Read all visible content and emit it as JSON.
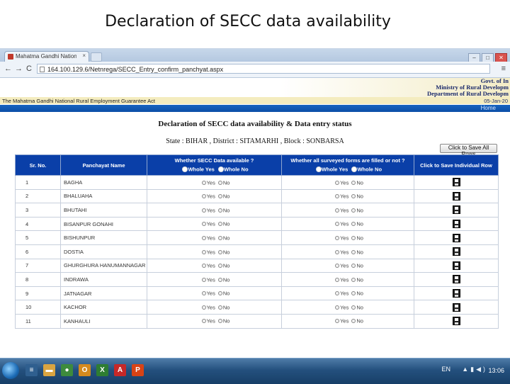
{
  "slide": {
    "title": "Declaration of SECC data availability"
  },
  "browser": {
    "tab_label": "Mahatma Gandhi National",
    "tab_close": "×",
    "window_buttons": [
      "–",
      "□",
      "✕"
    ],
    "back": "←",
    "forward": "→",
    "reload": "C",
    "url": "164.100.129.6/Netnrega/SECC_Entry_confirm_panchyat.aspx",
    "menu": "≡"
  },
  "header": {
    "gov_lines": [
      "Govt. of In",
      "Ministry of Rural Developm",
      "Department of Rural Developm"
    ],
    "act_text": "The Mahatma Gandhi National Rural Employment Guarantee Act",
    "date": "05-Jan-20",
    "home_link": "Home"
  },
  "page": {
    "heading": "Declaration of SECC data availability & Data entry status",
    "state_line": "State : BIHAR , District : SITAMARHI , Block : SONBARSA",
    "save_all_button": "Click to Save All Rows"
  },
  "table": {
    "headers": {
      "sr_no": "Sr. No.",
      "panchayat": "Panchayat Name",
      "secc_q": "Whether SECC Data available ?",
      "forms_q": "Whether all surveyed forms are filled or not ?",
      "save_col": "Click to Save Individual Row",
      "whole_yes": "Whole Yes",
      "whole_no": "Whole No"
    },
    "yes_label": "Yes",
    "no_label": "No",
    "rows": [
      {
        "sr": "1",
        "name": "BAGHA"
      },
      {
        "sr": "2",
        "name": "BHALUAHA"
      },
      {
        "sr": "3",
        "name": "BHUTAHI"
      },
      {
        "sr": "4",
        "name": "BISANPUR GONAHI"
      },
      {
        "sr": "5",
        "name": "BISHUNPUR"
      },
      {
        "sr": "6",
        "name": "DOSTIA"
      },
      {
        "sr": "7",
        "name": "GHURGHURA HANUMANNAGAR"
      },
      {
        "sr": "8",
        "name": "INDRAWA"
      },
      {
        "sr": "9",
        "name": "JATNAGAR"
      },
      {
        "sr": "10",
        "name": "KACHOR"
      },
      {
        "sr": "11",
        "name": "KANHAULI"
      }
    ]
  },
  "taskbar": {
    "apps": [
      {
        "icon": "explorer-icon",
        "glyph": "≡",
        "color": "#2f5f8f"
      },
      {
        "icon": "folder-icon",
        "glyph": "▬",
        "color": "#d9a441"
      },
      {
        "icon": "chrome-icon",
        "glyph": "●",
        "color": "#3d8b3d"
      },
      {
        "icon": "outlook-icon",
        "glyph": "O",
        "color": "#d58a1e"
      },
      {
        "icon": "excel-icon",
        "glyph": "X",
        "color": "#2e7d32"
      },
      {
        "icon": "acrobat-icon",
        "glyph": "A",
        "color": "#c62828"
      },
      {
        "icon": "powerpoint-icon",
        "glyph": "P",
        "color": "#d84315"
      }
    ],
    "lang": "EN",
    "clock": "13:06"
  }
}
